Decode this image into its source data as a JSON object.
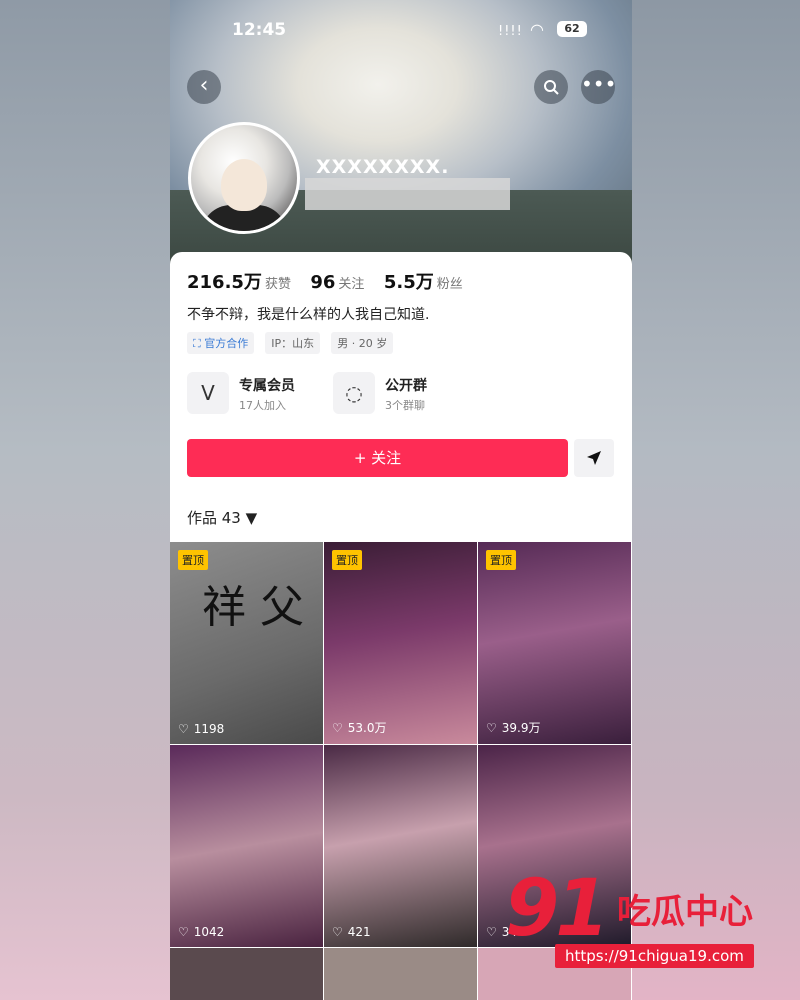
{
  "status_bar": {
    "time": "12:45",
    "signal": "!!!!",
    "wifi": "◠",
    "battery": "62"
  },
  "header": {
    "username": "XXXXXXXX."
  },
  "stats": [
    {
      "value": "216.5万",
      "label": "获赞"
    },
    {
      "value": "96",
      "label": "关注"
    },
    {
      "value": "5.5万",
      "label": "粉丝"
    }
  ],
  "bio": "不争不辩，我是什么样的人我自己知道.",
  "tags": [
    "官方合作",
    "IP：山东",
    "男 · 20 岁"
  ],
  "features": [
    {
      "title": "专属会员",
      "subtitle": "17人加入"
    },
    {
      "title": "公开群",
      "subtitle": "3个群聊"
    }
  ],
  "follow_label": "+ 关注",
  "works_label": "作品 43 ▼",
  "pin_label": "置顶",
  "videos": [
    {
      "likes": "1198",
      "pinned": true,
      "text": "祥 父"
    },
    {
      "likes": "53.0万",
      "pinned": true
    },
    {
      "likes": "39.9万",
      "pinned": true
    },
    {
      "likes": "1042"
    },
    {
      "likes": "421"
    },
    {
      "likes": "34"
    }
  ],
  "watermark": {
    "number": "91",
    "text": "吃瓜中心",
    "url": "https://91chigua19.com"
  },
  "colors": {
    "accent": "#fe2c55",
    "pin": "#ffc300",
    "watermark": "#e8203a"
  }
}
